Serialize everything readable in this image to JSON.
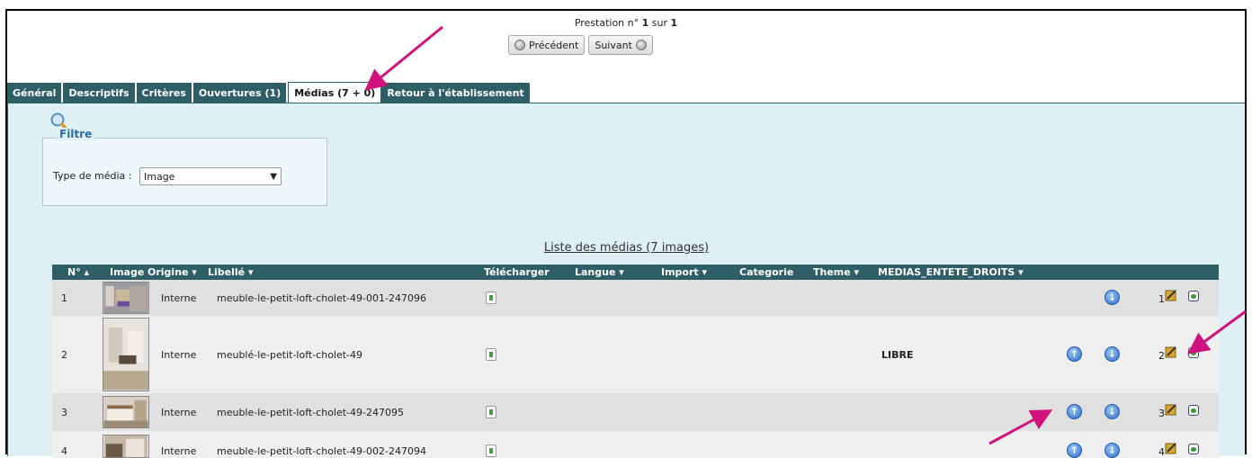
{
  "pager": {
    "label": "Prestation n°",
    "current": "1",
    "sep": "sur",
    "total": "1",
    "prev_label": "Précédent",
    "next_label": "Suivant"
  },
  "tabs": [
    {
      "label": "Général"
    },
    {
      "label": "Descriptifs"
    },
    {
      "label": "Critères"
    },
    {
      "label": "Ouvertures (1)"
    },
    {
      "label": "Médias  (7 + 0)",
      "active": true
    },
    {
      "label": "Retour à l'établissement"
    }
  ],
  "filter": {
    "legend": "Filtre",
    "type_label": "Type de média :",
    "type_value": "Image"
  },
  "list": {
    "title": "Liste des médias (7 images)",
    "headers": {
      "num": "N° ▴",
      "image": "Image",
      "origine": "Origine ▾",
      "libelle": "Libellé ▾",
      "telecharger": "Télécharger",
      "langue": "Langue ▾",
      "import": "Import ▾",
      "categorie": "Categorie",
      "theme": "Theme ▾",
      "droits": "MEDIAS_ENTETE_DROITS ▾"
    },
    "rows": [
      {
        "num": "1",
        "origine": "Interne",
        "libelle": "meuble-le-petit-loft-cholet-49-001-247096",
        "droits": "",
        "order": "1"
      },
      {
        "num": "2",
        "origine": "Interne",
        "libelle": "meublé-le-petit-loft-cholet-49",
        "droits": "LIBRE",
        "order": "2"
      },
      {
        "num": "3",
        "origine": "Interne",
        "libelle": "meuble-le-petit-loft-cholet-49-247095",
        "droits": "",
        "order": "3"
      },
      {
        "num": "4",
        "origine": "Interne",
        "libelle": "meuble-le-petit-loft-cholet-49-002-247094",
        "droits": "",
        "order": "4"
      }
    ]
  },
  "icons": {
    "up": "arrow-up-circle-icon",
    "down": "arrow-down-circle-icon",
    "edit": "edit-icon",
    "delete": "delete-icon",
    "download": "download-icon",
    "search": "magnifier-icon"
  },
  "colors": {
    "tab_bg": "#2f5f66",
    "content_bg": "#dff0f4",
    "annotation": "#d0127e",
    "link_blue": "#2f6ba8"
  }
}
